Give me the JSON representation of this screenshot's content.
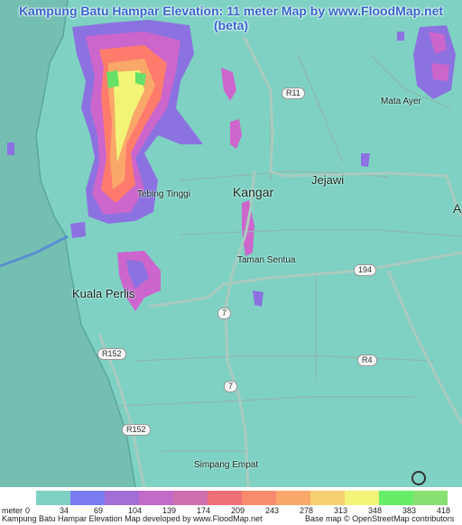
{
  "title": "Kampung Batu Hampar Elevation: 11 meter Map by www.FloodMap.net (beta)",
  "places": {
    "kangar": "Kangar",
    "jejawi": "Jejawi",
    "tebing_tinggi": "Tebing Tinggi",
    "taman_sentua": "Taman Sentua",
    "kuala_perlis": "Kuala Perlis",
    "mata_ayer": "Mata Ayer",
    "simpang_empat": "Simpang Empat",
    "edge_a": "A"
  },
  "roads": {
    "r11": "R11",
    "r194": "194",
    "r7a": "7",
    "r7b": "7",
    "r4": "R4",
    "r152a": "R152",
    "r152b": "R152"
  },
  "colors": {
    "land": "#7fd1c4",
    "sea": "#74bfb2",
    "elev_low": "#8080ee",
    "elev_mid": "#cc66cc",
    "elev_high": "#ff7c6c",
    "elev_top": "#ffff66",
    "peak": "#66e066"
  },
  "legend": {
    "unit_label": "meter",
    "ticks": [
      "0",
      "34",
      "69",
      "104",
      "139",
      "174",
      "209",
      "243",
      "278",
      "313",
      "348",
      "383",
      "418"
    ],
    "colors": [
      "#7fd1c4",
      "#7b7bf0",
      "#a36ed6",
      "#c46ac9",
      "#d06fb0",
      "#f0707a",
      "#f88a6e",
      "#f9a86a",
      "#f6cf70",
      "#f1f477",
      "#66ee66",
      "#88e070"
    ],
    "developer_text": "Kampung Batu Hampar Elevation Map developed by www.FloodMap.net",
    "basemap_text": "Base map © OpenStreetMap contributors"
  },
  "osm_logo_text": "OpenStreetMap"
}
